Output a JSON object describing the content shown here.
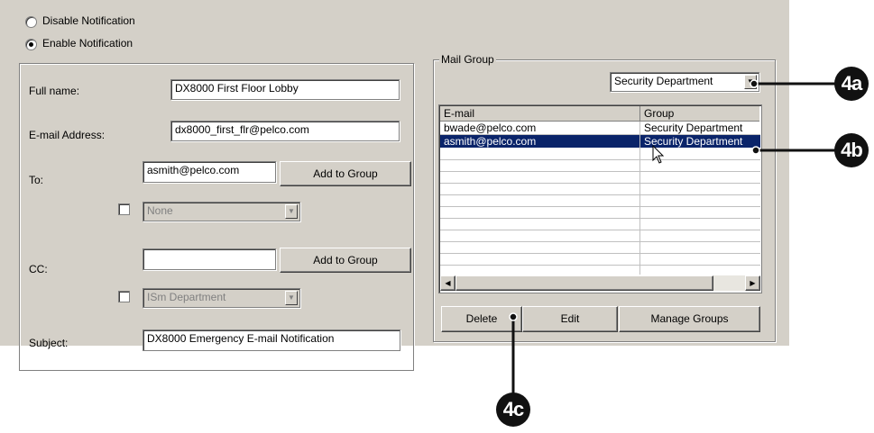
{
  "notification": {
    "disable_label": "Disable Notification",
    "enable_label": "Enable Notification"
  },
  "form": {
    "full_name_label": "Full name:",
    "full_name_value": "DX8000 First Floor Lobby",
    "email_label": "E-mail Address:",
    "email_value": "dx8000_first_flr@pelco.com",
    "to_label": "To:",
    "to_value": "asmith@pelco.com",
    "to_add_button": "Add to Group",
    "to_group_select": "None",
    "cc_label": "CC:",
    "cc_value": "",
    "cc_add_button": "Add to Group",
    "cc_group_select": "ISm Department",
    "subject_label": "Subject:",
    "subject_value": "DX8000 Emergency E-mail Notification"
  },
  "mail_group": {
    "title": "Mail Group",
    "group_select": "Security Department",
    "columns": [
      "E-mail",
      "Group"
    ],
    "rows": [
      {
        "email": "bwade@pelco.com",
        "group": "Security Department"
      },
      {
        "email": "asmith@pelco.com",
        "group": "Security Department"
      }
    ],
    "delete_button": "Delete",
    "edit_button": "Edit",
    "manage_button": "Manage Groups"
  },
  "callouts": {
    "a": "4a",
    "b": "4b",
    "c": "4c"
  }
}
